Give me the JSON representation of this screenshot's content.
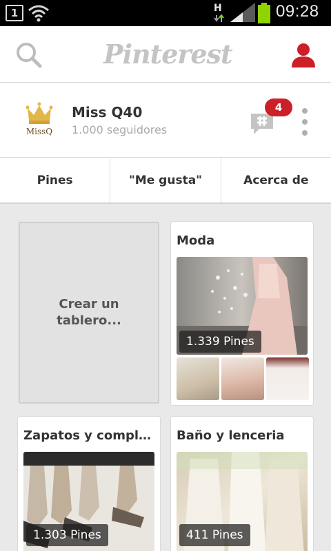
{
  "status_bar": {
    "notification_count": "1",
    "network_type": "H",
    "time": "09:28"
  },
  "header": {
    "logo_text": "Pinterest",
    "search_icon": "search-icon",
    "profile_icon": "user-icon",
    "accent": "#cb2027"
  },
  "profile": {
    "name": "Miss Q40",
    "followers": "1.000 seguidores",
    "avatar_text": "MissQ",
    "message_badge": "4"
  },
  "tabs": [
    {
      "label": "Pines"
    },
    {
      "label": "\"Me gusta\""
    },
    {
      "label": "Acerca de"
    }
  ],
  "create_board": {
    "label": "Crear un\ntablero..."
  },
  "boards": [
    {
      "title": "Moda",
      "pins": "1.339 Pines"
    },
    {
      "title": "Zapatos y complem...",
      "pins": "1.303 Pines"
    },
    {
      "title": "Baño y lenceria",
      "pins": "411 Pines"
    }
  ]
}
